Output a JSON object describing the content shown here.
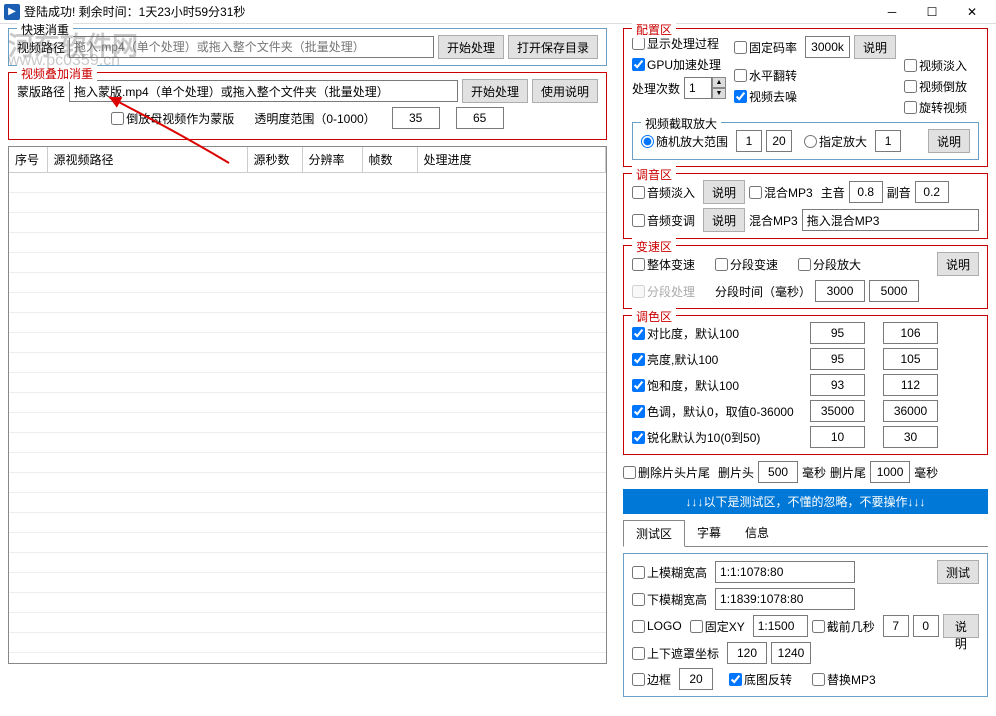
{
  "titlebar": {
    "title": "登陆成功! 剩余时间：1天23小时59分31秒"
  },
  "watermark": {
    "line1": "河东软件网",
    "line2": "www.pc0359.cn"
  },
  "quickDedup": {
    "legend": "快速消重",
    "pathLabel": "视频路径",
    "pathPlaceholder": "拖入.mp4（单个处理）或拖入整个文件夹（批量处理）",
    "startBtn": "开始处理",
    "openDirBtn": "打开保存目录"
  },
  "overlayDedup": {
    "legend": "视频叠加消重",
    "maskLabel": "蒙版路径",
    "maskPlaceholder": "拖入蒙版.mp4（单个处理）或拖入整个文件夹（批量处理）",
    "startBtn": "开始处理",
    "helpBtn": "使用说明",
    "reverseLabel": "倒放母视频作为蒙版",
    "opacityLabel": "透明度范围（0-1000）",
    "opacityMin": "35",
    "opacityMax": "65"
  },
  "table": {
    "cols": [
      "序号",
      "源视频路径",
      "源秒数",
      "分辨率",
      "帧数",
      "处理进度"
    ]
  },
  "config": {
    "legend": "配置区",
    "showProcess": "显示处理过程",
    "gpuAccel": "GPU加速处理",
    "processCountLabel": "处理次数",
    "processCount": "1",
    "fixedBitrate": "固定码率",
    "bitrateValue": "3000k",
    "explainBtn": "说明",
    "hFlip": "水平翻转",
    "denoise": "视频去噪",
    "fadeIn": "视频淡入",
    "reverse": "视频倒放",
    "rotate": "旋转视频"
  },
  "cropZoom": {
    "legend": "视频截取放大",
    "randomZoom": "随机放大范围",
    "randomMin": "1",
    "randomMax": "20",
    "fixedZoom": "指定放大",
    "fixedValue": "1",
    "explainBtn": "说明"
  },
  "audio": {
    "legend": "调音区",
    "audioFadeIn": "音频淡入",
    "explain1": "说明",
    "mixMp3": "混合MP3",
    "mainVolLabel": "主音",
    "mainVol": "0.8",
    "subVolLabel": "副音",
    "subVol": "0.2",
    "audioSpeed": "音频变调",
    "explain2": "说明",
    "mixMp3Label": "混合MP3",
    "mixMp3Path": "拖入混合MP3"
  },
  "speed": {
    "legend": "变速区",
    "overallSpeed": "整体变速",
    "segmentSpeed": "分段变速",
    "segmentZoom": "分段放大",
    "explainBtn": "说明",
    "segmentProcess": "分段处理",
    "segmentTimeLabel": "分段时间（毫秒）",
    "segMin": "3000",
    "segMax": "5000"
  },
  "color": {
    "legend": "调色区",
    "contrast": "对比度，默认100",
    "contrastMin": "95",
    "contrastMax": "106",
    "brightness": "亮度,默认100",
    "brightMin": "95",
    "brightMax": "105",
    "saturation": "饱和度，默认100",
    "satMin": "93",
    "satMax": "112",
    "hue": "色调，默认0，取值0-36000",
    "hueMin": "35000",
    "hueMax": "36000",
    "sharpen": "锐化默认为10(0到50)",
    "sharpMin": "10",
    "sharpMax": "30"
  },
  "trim": {
    "trimLabel": "删除片头片尾",
    "headLabel": "删片头",
    "headVal": "500",
    "msLabel1": "毫秒",
    "tailLabel": "删片尾",
    "tailVal": "1000",
    "msLabel2": "毫秒"
  },
  "testBar": "↓↓↓以下是测试区，不懂的忽略，不要操作↓↓↓",
  "tabs": {
    "test": "测试区",
    "subtitle": "字幕",
    "info": "信息"
  },
  "testArea": {
    "upperBlur": "上模糊宽高",
    "upperBlurVal": "1:1:1078:80",
    "testBtn": "测试",
    "lowerBlur": "下模糊宽高",
    "lowerBlurVal": "1:1839:1078:80",
    "logo": "LOGO",
    "fixedXY": "固定XY",
    "fixedXYVal": "1:1500",
    "cutFront": "截前几秒",
    "cutVal1": "7",
    "cutVal2": "0",
    "explainBtn": "说明",
    "maskCoord": "上下遮罩坐标",
    "maskMin": "120",
    "maskMax": "1240",
    "border": "边框",
    "borderVal": "20",
    "bottomReverse": "底图反转",
    "replaceMp3": "替换MP3"
  }
}
